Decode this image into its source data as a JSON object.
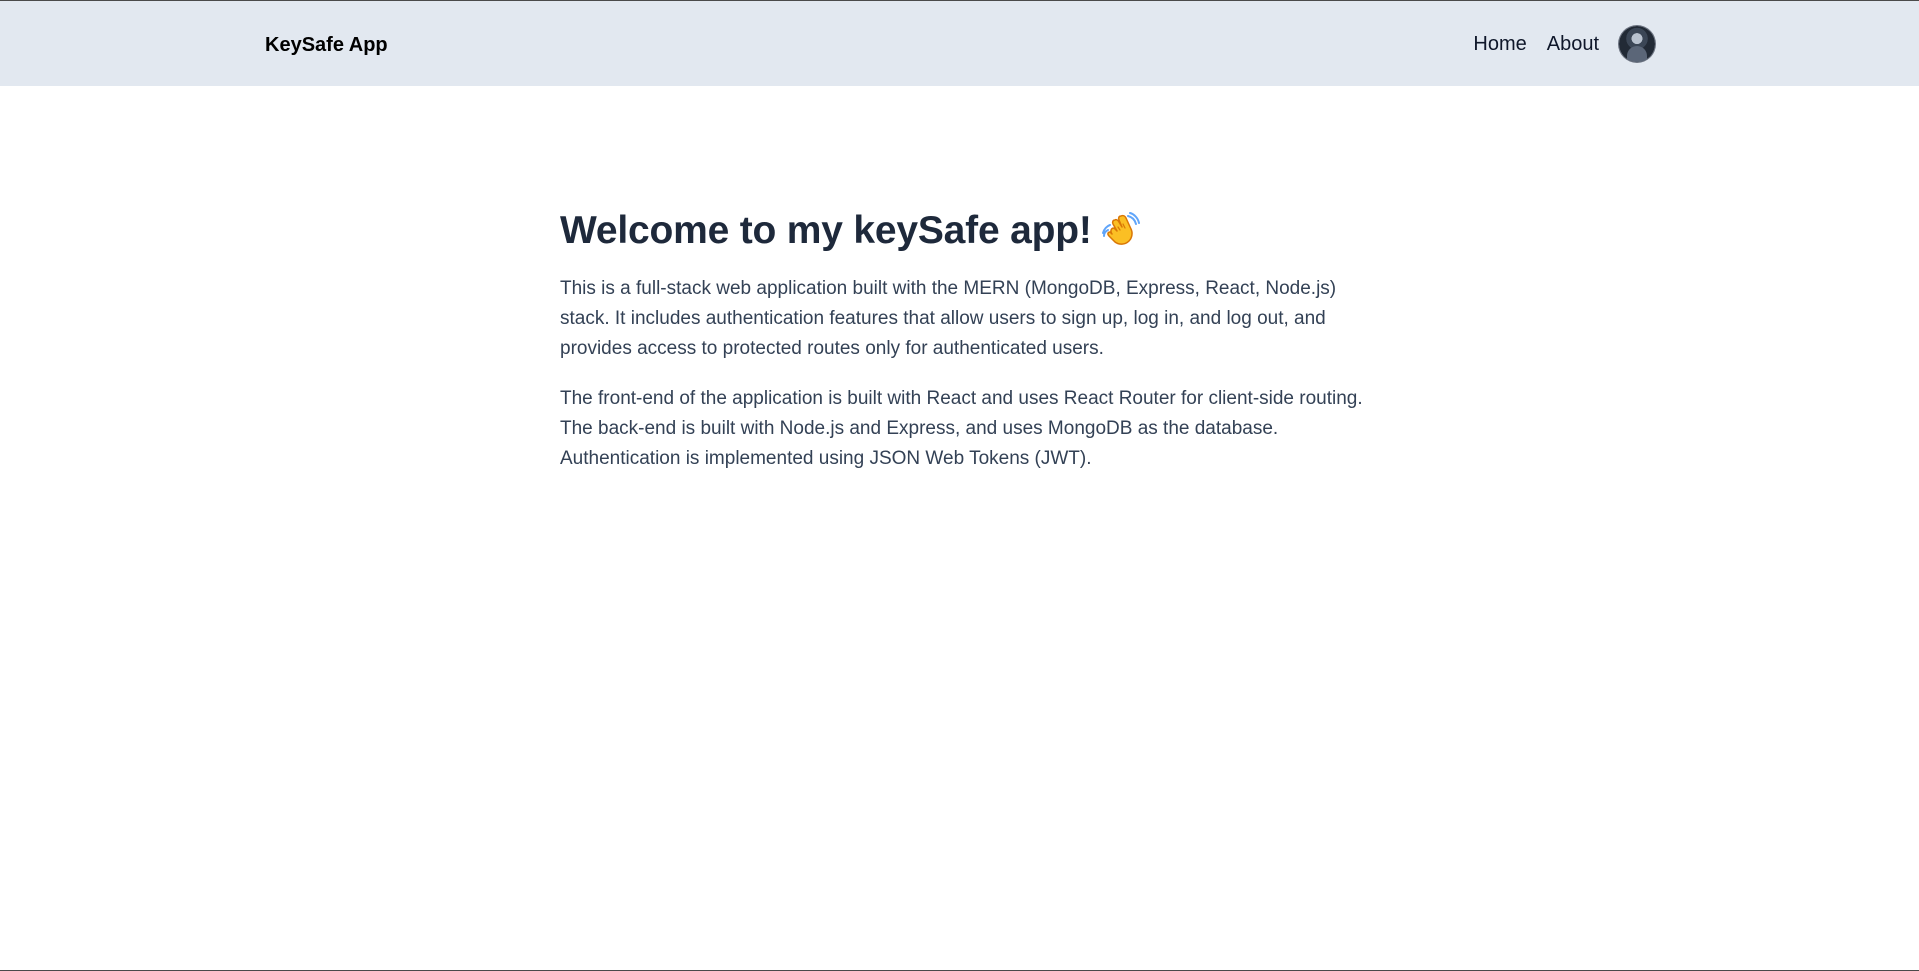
{
  "navbar": {
    "brand": "KeySafe App",
    "links": [
      {
        "label": "Home"
      },
      {
        "label": "About"
      }
    ],
    "avatar_alt": "user avatar"
  },
  "main": {
    "title": "Welcome to my keySafe app!",
    "title_icon": "waving-hand-icon",
    "paragraphs": [
      "This is a full-stack web application built with the MERN (MongoDB, Express, React, Node.js) stack. It includes authentication features that allow users to sign up, log in, and log out, and provides access to protected routes only for authenticated users.",
      "The front-end of the application is built with React and uses React Router for client-side routing. The back-end is built with Node.js and Express, and uses MongoDB as the database. Authentication is implemented using JSON Web Tokens (JWT)."
    ]
  },
  "colors": {
    "navbar_bg": "#e2e8f0",
    "heading": "#1e293b",
    "body_text": "#334155"
  }
}
